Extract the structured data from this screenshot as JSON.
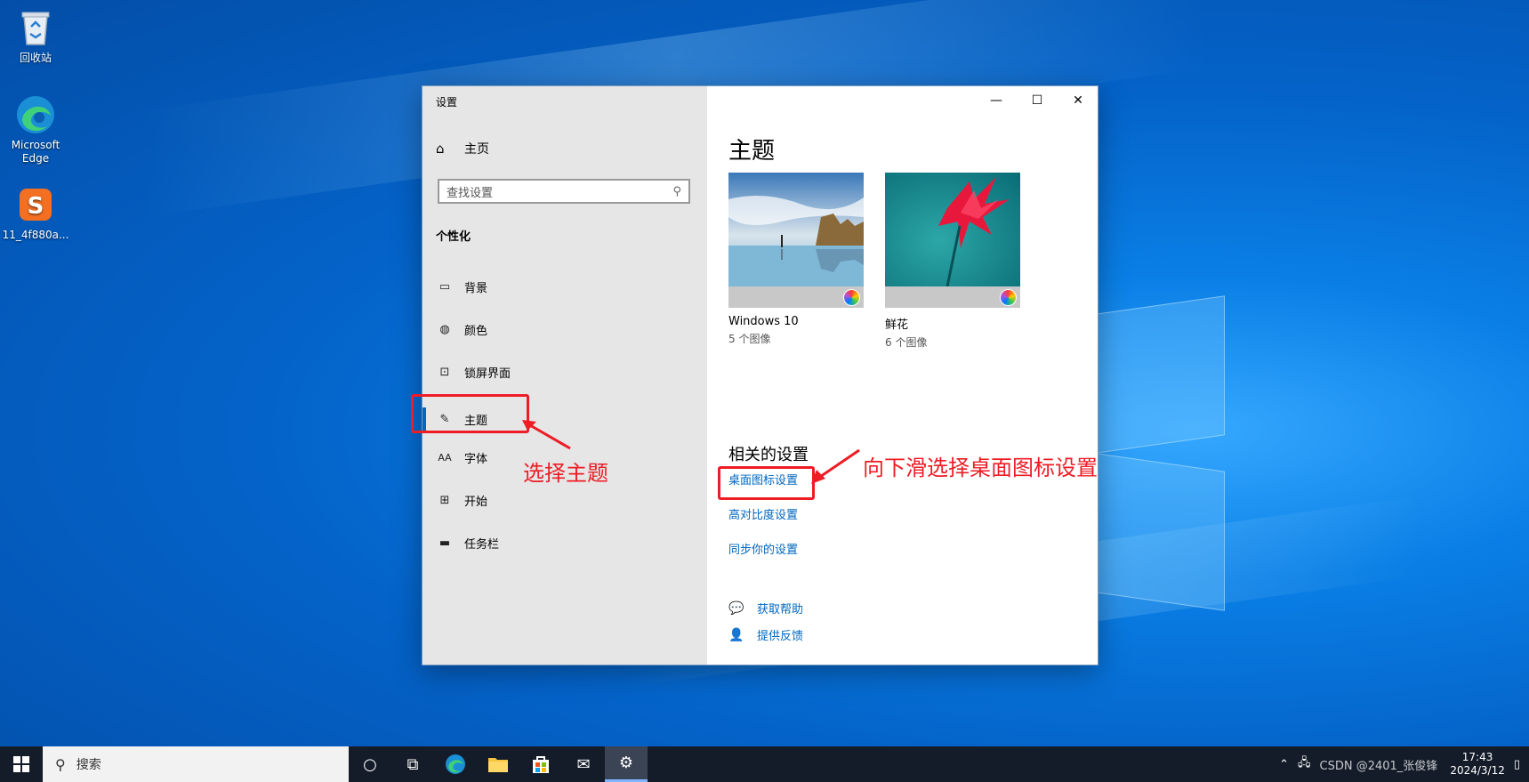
{
  "desktop": {
    "icons": [
      {
        "label": "回收站"
      },
      {
        "label": "Microsoft Edge"
      },
      {
        "label": "11_4f880a..."
      }
    ]
  },
  "window": {
    "title": "设置",
    "controls": {
      "minimize": "—",
      "maximize": "☐",
      "close": "✕"
    }
  },
  "sidebar": {
    "home": "主页",
    "search_placeholder": "查找设置",
    "section": "个性化",
    "items": [
      {
        "label": "背景",
        "icon": "image-icon"
      },
      {
        "label": "颜色",
        "icon": "palette-icon"
      },
      {
        "label": "锁屏界面",
        "icon": "lock-screen-icon"
      },
      {
        "label": "主题",
        "icon": "theme-icon"
      },
      {
        "label": "字体",
        "icon": "font-icon"
      },
      {
        "label": "开始",
        "icon": "start-icon"
      },
      {
        "label": "任务栏",
        "icon": "taskbar-icon"
      }
    ],
    "selected": "主题"
  },
  "main": {
    "title": "主题",
    "themes": [
      {
        "name": "Windows 10",
        "count": "5 个图像"
      },
      {
        "name": "鲜花",
        "count": "6 个图像"
      }
    ],
    "related_title": "相关的设置",
    "related_links": [
      "桌面图标设置",
      "高对比度设置",
      "同步你的设置"
    ],
    "help": [
      "获取帮助",
      "提供反馈"
    ]
  },
  "annotations": {
    "select_theme": "选择主题",
    "scroll_down": "向下滑选择桌面图标设置"
  },
  "taskbar": {
    "search_label": "搜索",
    "time": "17:43",
    "date": "2024/3/12",
    "watermark": "CSDN @2401_张俊锋"
  }
}
